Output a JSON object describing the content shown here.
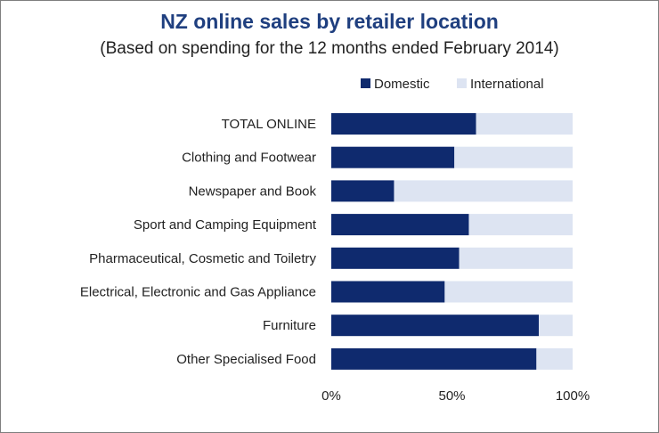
{
  "chart_data": {
    "type": "bar",
    "orientation": "horizontal",
    "stacked": "percent",
    "title": "NZ online sales by retailer location",
    "subtitle": "(Based on spending for the 12 months ended February 2014)",
    "categories": [
      "TOTAL ONLINE",
      "Clothing and Footwear",
      "Newspaper and Book",
      "Sport and Camping Equipment",
      "Pharmaceutical, Cosmetic and Toiletry",
      "Electrical, Electronic and Gas Appliance",
      "Furniture",
      "Other Specialised Food"
    ],
    "series": [
      {
        "name": "Domestic",
        "color": "#0f2a6e",
        "values": [
          60,
          51,
          26,
          57,
          53,
          47,
          86,
          85
        ]
      },
      {
        "name": "International",
        "color": "#dde4f2",
        "values": [
          40,
          49,
          74,
          43,
          47,
          53,
          14,
          15
        ]
      }
    ],
    "xlim": [
      0,
      100
    ],
    "x_ticks": [
      0,
      50,
      100
    ],
    "x_tick_labels": [
      "0%",
      "50%",
      "100%"
    ],
    "legend_position": "top-right",
    "grid": false
  }
}
